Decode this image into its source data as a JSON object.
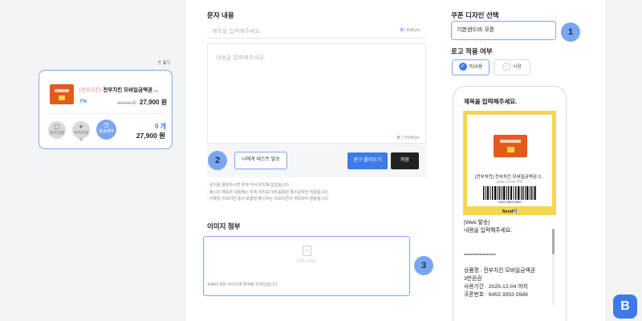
{
  "colors": {
    "accent": "#3f7be8",
    "highlight": "#7ea6f2",
    "coupon_bg": "#f5d64c",
    "product": "#e35a1b"
  },
  "product_list": {
    "total_prefix": "총 ",
    "total_count": "1",
    "total_suffix": "개",
    "card": {
      "brand": "[전부치킨]",
      "name": "전부치킨 모바일금액권 ...",
      "discount": "7%",
      "original_price": "30,000 원",
      "price": "27,900 원",
      "buttons": [
        {
          "label": "문자내용",
          "icon": "message-icon"
        },
        {
          "label": "이미지첨부",
          "icon": "person-icon"
        },
        {
          "label": "발송예약",
          "icon": "clock-icon"
        }
      ],
      "quantity": "0 개",
      "total": "27,900 원"
    }
  },
  "message": {
    "section_label": "문자 내용",
    "title_placeholder": "제목을 입력해주세요.",
    "title_counter_value": "0",
    "title_counter_max": " / 80Byte",
    "body_placeholder": "내용을 입력해주세요.",
    "body_counter_value": "0",
    "body_counter_max": " / 760Byte",
    "test_send_button": "나에게 테스트 발송",
    "load_button": "문구 불러오기",
    "save_button": "저장",
    "notes": [
      "· 문자를 클릭하시면 현재 커서 위치에 삽입됩니다.",
      "· 메시지 제목과 내용에는 우측 미리보기에 등록된 특수문자만 허용됩니다.",
      "· 이메일 이모티콘 등이 포함된 메시지는 미오티콘이 생략되어 발송됩니다."
    ]
  },
  "image_attach": {
    "section_label": "이미지 첨부",
    "upload_label": "UPLOAD",
    "upload_icon": "upload-icon",
    "note": "※450×300 사이즈에 최적화 되어있습니다."
  },
  "design": {
    "section_label": "쿠폰 디자인 선택",
    "selected": "기본샌드비 쿠폰",
    "logo_label": "로고 적용 여부",
    "logo_options": [
      {
        "label": "미사용",
        "selected": true
      },
      {
        "label": "사용",
        "selected": false
      }
    ]
  },
  "preview": {
    "title": "제목을 입력해주세요.",
    "coupon_name": "[전부치킨] 전부치킨 모바일금액권 3...",
    "coupon_date": "2025-12-04 까지",
    "coupon_number": "9453 3553 5569",
    "send_brand": "Send",
    "send_brand_suffix": "비",
    "body_lines": [
      "[Web 발송]",
      "내용을 입력해주세요.",
      "",
      "",
      "==========",
      "",
      "상품명 : 전부치킨 모바일금액권",
      "3만원권",
      "사용기간 : 2025-12-04 까지",
      "쿠폰번호 : 9453 3553 5569"
    ]
  },
  "step_badges": [
    "1",
    "2",
    "3"
  ],
  "fab": {
    "label": "B"
  }
}
